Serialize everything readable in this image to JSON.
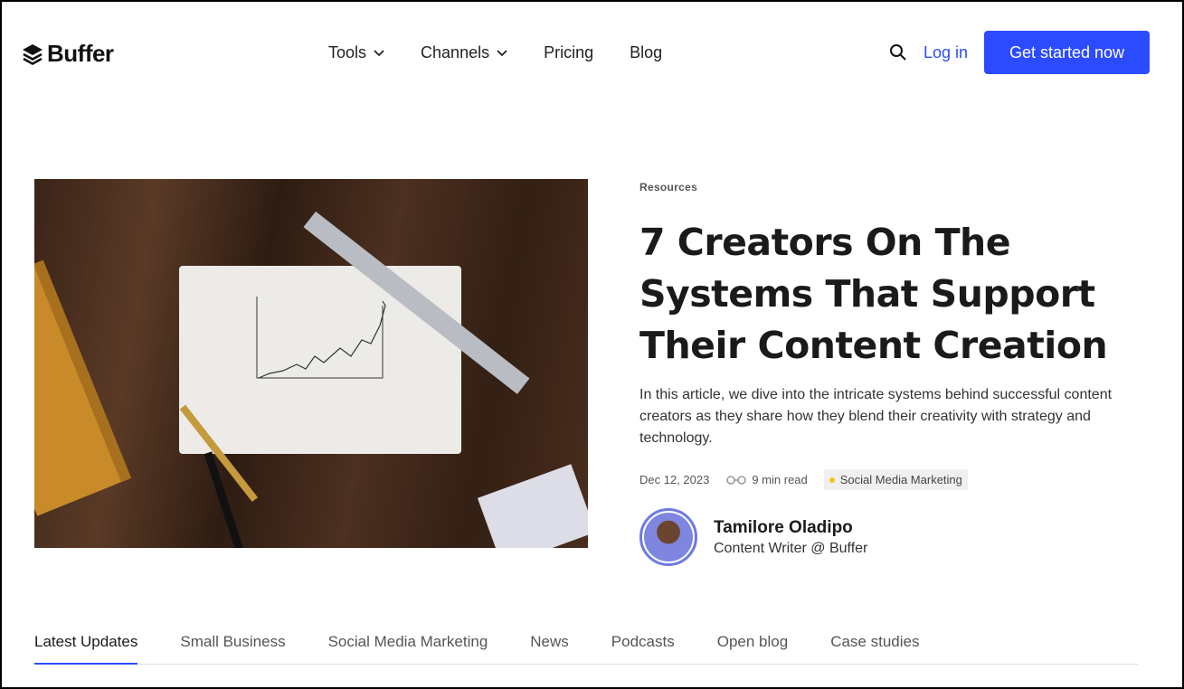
{
  "nav": {
    "logo": "Buffer",
    "menu": [
      {
        "label": "Tools"
      },
      {
        "label": "Channels"
      },
      {
        "label": "Pricing"
      },
      {
        "label": "Blog"
      }
    ],
    "login": "Log in",
    "cta": "Get started now"
  },
  "article": {
    "category": "Resources",
    "title": "7 Creators On The Systems That Support Their Content Creation",
    "description": "In this article, we dive into the intricate systems behind successful content creators as they share how they blend their creativity with strategy and technology.",
    "date": "Dec 12, 2023",
    "read_time": "9 min read",
    "tag": "Social Media Marketing",
    "author": {
      "name": "Tamilore Oladipo",
      "role": "Content Writer @ Buffer"
    }
  },
  "tabs": [
    "Latest Updates",
    "Small Business",
    "Social Media Marketing",
    "News",
    "Podcasts",
    "Open blog",
    "Case studies"
  ],
  "colors": {
    "accent": "#2c4bff",
    "tag_dot": "#f5c518"
  }
}
